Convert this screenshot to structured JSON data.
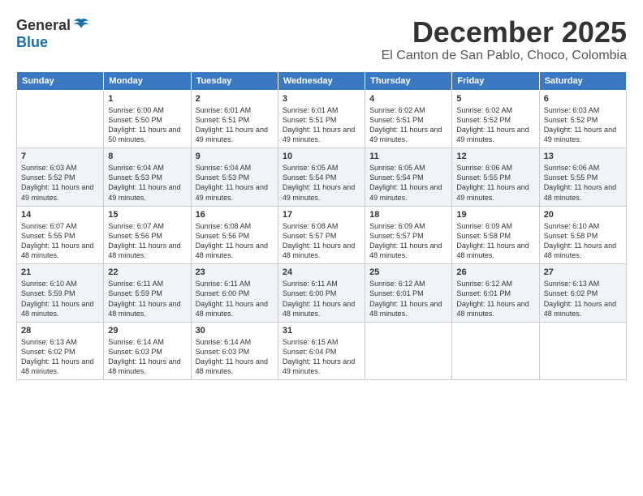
{
  "header": {
    "logo_general": "General",
    "logo_blue": "Blue",
    "month": "December 2025",
    "location": "El Canton de San Pablo, Choco, Colombia"
  },
  "weekdays": [
    "Sunday",
    "Monday",
    "Tuesday",
    "Wednesday",
    "Thursday",
    "Friday",
    "Saturday"
  ],
  "weeks": [
    [
      {
        "day": "",
        "sunrise": "",
        "sunset": "",
        "daylight": ""
      },
      {
        "day": "1",
        "sunrise": "Sunrise: 6:00 AM",
        "sunset": "Sunset: 5:50 PM",
        "daylight": "Daylight: 11 hours and 50 minutes."
      },
      {
        "day": "2",
        "sunrise": "Sunrise: 6:01 AM",
        "sunset": "Sunset: 5:51 PM",
        "daylight": "Daylight: 11 hours and 49 minutes."
      },
      {
        "day": "3",
        "sunrise": "Sunrise: 6:01 AM",
        "sunset": "Sunset: 5:51 PM",
        "daylight": "Daylight: 11 hours and 49 minutes."
      },
      {
        "day": "4",
        "sunrise": "Sunrise: 6:02 AM",
        "sunset": "Sunset: 5:51 PM",
        "daylight": "Daylight: 11 hours and 49 minutes."
      },
      {
        "day": "5",
        "sunrise": "Sunrise: 6:02 AM",
        "sunset": "Sunset: 5:52 PM",
        "daylight": "Daylight: 11 hours and 49 minutes."
      },
      {
        "day": "6",
        "sunrise": "Sunrise: 6:03 AM",
        "sunset": "Sunset: 5:52 PM",
        "daylight": "Daylight: 11 hours and 49 minutes."
      }
    ],
    [
      {
        "day": "7",
        "sunrise": "Sunrise: 6:03 AM",
        "sunset": "Sunset: 5:52 PM",
        "daylight": "Daylight: 11 hours and 49 minutes."
      },
      {
        "day": "8",
        "sunrise": "Sunrise: 6:04 AM",
        "sunset": "Sunset: 5:53 PM",
        "daylight": "Daylight: 11 hours and 49 minutes."
      },
      {
        "day": "9",
        "sunrise": "Sunrise: 6:04 AM",
        "sunset": "Sunset: 5:53 PM",
        "daylight": "Daylight: 11 hours and 49 minutes."
      },
      {
        "day": "10",
        "sunrise": "Sunrise: 6:05 AM",
        "sunset": "Sunset: 5:54 PM",
        "daylight": "Daylight: 11 hours and 49 minutes."
      },
      {
        "day": "11",
        "sunrise": "Sunrise: 6:05 AM",
        "sunset": "Sunset: 5:54 PM",
        "daylight": "Daylight: 11 hours and 49 minutes."
      },
      {
        "day": "12",
        "sunrise": "Sunrise: 6:06 AM",
        "sunset": "Sunset: 5:55 PM",
        "daylight": "Daylight: 11 hours and 49 minutes."
      },
      {
        "day": "13",
        "sunrise": "Sunrise: 6:06 AM",
        "sunset": "Sunset: 5:55 PM",
        "daylight": "Daylight: 11 hours and 48 minutes."
      }
    ],
    [
      {
        "day": "14",
        "sunrise": "Sunrise: 6:07 AM",
        "sunset": "Sunset: 5:55 PM",
        "daylight": "Daylight: 11 hours and 48 minutes."
      },
      {
        "day": "15",
        "sunrise": "Sunrise: 6:07 AM",
        "sunset": "Sunset: 5:56 PM",
        "daylight": "Daylight: 11 hours and 48 minutes."
      },
      {
        "day": "16",
        "sunrise": "Sunrise: 6:08 AM",
        "sunset": "Sunset: 5:56 PM",
        "daylight": "Daylight: 11 hours and 48 minutes."
      },
      {
        "day": "17",
        "sunrise": "Sunrise: 6:08 AM",
        "sunset": "Sunset: 5:57 PM",
        "daylight": "Daylight: 11 hours and 48 minutes."
      },
      {
        "day": "18",
        "sunrise": "Sunrise: 6:09 AM",
        "sunset": "Sunset: 5:57 PM",
        "daylight": "Daylight: 11 hours and 48 minutes."
      },
      {
        "day": "19",
        "sunrise": "Sunrise: 6:09 AM",
        "sunset": "Sunset: 5:58 PM",
        "daylight": "Daylight: 11 hours and 48 minutes."
      },
      {
        "day": "20",
        "sunrise": "Sunrise: 6:10 AM",
        "sunset": "Sunset: 5:58 PM",
        "daylight": "Daylight: 11 hours and 48 minutes."
      }
    ],
    [
      {
        "day": "21",
        "sunrise": "Sunrise: 6:10 AM",
        "sunset": "Sunset: 5:59 PM",
        "daylight": "Daylight: 11 hours and 48 minutes."
      },
      {
        "day": "22",
        "sunrise": "Sunrise: 6:11 AM",
        "sunset": "Sunset: 5:59 PM",
        "daylight": "Daylight: 11 hours and 48 minutes."
      },
      {
        "day": "23",
        "sunrise": "Sunrise: 6:11 AM",
        "sunset": "Sunset: 6:00 PM",
        "daylight": "Daylight: 11 hours and 48 minutes."
      },
      {
        "day": "24",
        "sunrise": "Sunrise: 6:11 AM",
        "sunset": "Sunset: 6:00 PM",
        "daylight": "Daylight: 11 hours and 48 minutes."
      },
      {
        "day": "25",
        "sunrise": "Sunrise: 6:12 AM",
        "sunset": "Sunset: 6:01 PM",
        "daylight": "Daylight: 11 hours and 48 minutes."
      },
      {
        "day": "26",
        "sunrise": "Sunrise: 6:12 AM",
        "sunset": "Sunset: 6:01 PM",
        "daylight": "Daylight: 11 hours and 48 minutes."
      },
      {
        "day": "27",
        "sunrise": "Sunrise: 6:13 AM",
        "sunset": "Sunset: 6:02 PM",
        "daylight": "Daylight: 11 hours and 48 minutes."
      }
    ],
    [
      {
        "day": "28",
        "sunrise": "Sunrise: 6:13 AM",
        "sunset": "Sunset: 6:02 PM",
        "daylight": "Daylight: 11 hours and 48 minutes."
      },
      {
        "day": "29",
        "sunrise": "Sunrise: 6:14 AM",
        "sunset": "Sunset: 6:03 PM",
        "daylight": "Daylight: 11 hours and 48 minutes."
      },
      {
        "day": "30",
        "sunrise": "Sunrise: 6:14 AM",
        "sunset": "Sunset: 6:03 PM",
        "daylight": "Daylight: 11 hours and 48 minutes."
      },
      {
        "day": "31",
        "sunrise": "Sunrise: 6:15 AM",
        "sunset": "Sunset: 6:04 PM",
        "daylight": "Daylight: 11 hours and 49 minutes."
      },
      {
        "day": "",
        "sunrise": "",
        "sunset": "",
        "daylight": ""
      },
      {
        "day": "",
        "sunrise": "",
        "sunset": "",
        "daylight": ""
      },
      {
        "day": "",
        "sunrise": "",
        "sunset": "",
        "daylight": ""
      }
    ]
  ]
}
